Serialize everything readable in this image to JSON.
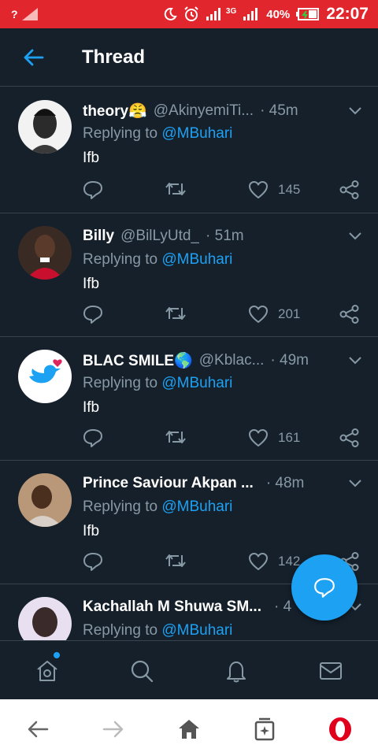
{
  "status_bar": {
    "sim_label": "?",
    "battery": "40%",
    "network": "3G",
    "time": "22:07",
    "background": "#e1262d"
  },
  "header": {
    "title": "Thread"
  },
  "tweets": [
    {
      "name": "theory😤",
      "handle": "@AkinyemiTi...",
      "time": "· 45m",
      "reply_prefix": "Replying to",
      "reply_to": "@MBuhari",
      "text": "Ifb",
      "likes": "145"
    },
    {
      "name": "Billy",
      "handle": "@BilLyUtd_",
      "time": "· 51m",
      "reply_prefix": "Replying to",
      "reply_to": "@MBuhari",
      "text": "Ifb",
      "likes": "201"
    },
    {
      "name": "BLAC SMILE🌎",
      "handle": "@Kblac...",
      "time": "· 49m",
      "reply_prefix": "Replying to",
      "reply_to": "@MBuhari",
      "text": "Ifb",
      "likes": "161"
    },
    {
      "name": "Prince Saviour Akpan ...",
      "handle": "",
      "time": "· 48m",
      "reply_prefix": "Replying to",
      "reply_to": "@MBuhari",
      "text": "Ifb",
      "likes": "142"
    },
    {
      "name": "Kachallah M Shuwa SM...",
      "handle": "",
      "time": "· 4",
      "reply_prefix": "Replying to",
      "reply_to": "@MBuhari",
      "text": "",
      "likes": ""
    }
  ],
  "colors": {
    "background": "#15202b",
    "accent": "#1da1f2",
    "muted": "#8899a6",
    "divider": "#38444d"
  },
  "icons": {
    "back": "arrow-left-icon",
    "reply": "comment-icon",
    "retweet": "retweet-icon",
    "like": "heart-icon",
    "share": "share-icon",
    "tabs": [
      "home-icon",
      "search-icon",
      "bell-icon",
      "mail-icon"
    ],
    "browser": [
      "back-arrow-icon",
      "forward-arrow-icon",
      "home-icon",
      "tabs-icon",
      "opera-icon"
    ]
  }
}
